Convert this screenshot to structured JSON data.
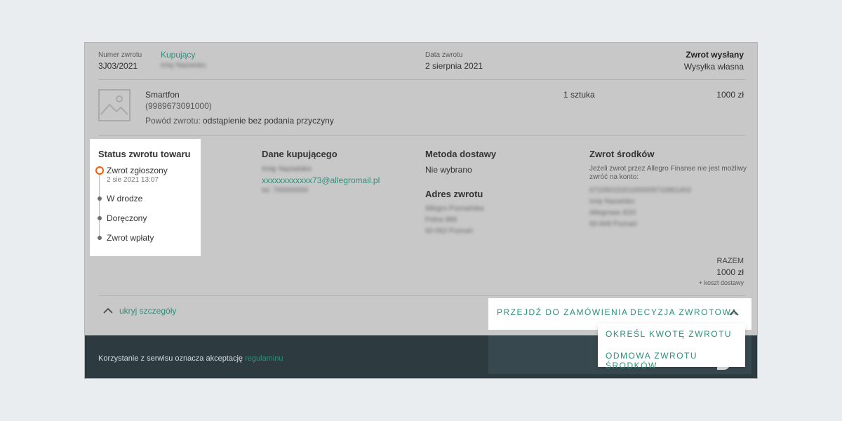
{
  "header": {
    "return_number_label": "Numer zwrotu",
    "return_number_value": "3J03/2021",
    "buyer_label": "Kupujący",
    "buyer_name": "Imię Nazwisko",
    "return_date_label": "Data zwrotu",
    "return_date_value": "2 sierpnia 2021",
    "status_title": "Zwrot wysłany",
    "status_subtitle": "Wysyłka własna"
  },
  "product": {
    "name": "Smartfon",
    "id": "(9989673091000)",
    "reason_label": "Powód zwrotu:",
    "reason_value": "odstąpienie bez podania przyczyny",
    "quantity": "1 sztuka",
    "price": "1000 zł",
    "image_icon": "image-placeholder-icon"
  },
  "status_panel": {
    "title": "Status zwrotu towaru",
    "steps": [
      {
        "label": "Zwrot zgłoszony",
        "date": "2 sie 2021 13:07"
      },
      {
        "label": "W drodze"
      },
      {
        "label": "Doręczony"
      },
      {
        "label": "Zwrot wpłaty"
      }
    ]
  },
  "buyer_data": {
    "title": "Dane kupującego",
    "name": "Imię Nazwisko",
    "email": "xxxxxxxxxxxx73@allegromail.pl",
    "phone": "tel. 700000000"
  },
  "delivery": {
    "title": "Metoda dostawy",
    "value": "Nie wybrano",
    "address_title": "Adres zwrotu",
    "address_lines": [
      "Allegro Poznańska",
      "Polna 989",
      "60-062 Poznań"
    ]
  },
  "refund": {
    "title": "Zwrot środków",
    "note": "Jeżeli zwrot przez Allegro Finanse nie jest możliwy zwróć na konto:",
    "lines": [
      "07105015201000009710861403",
      "Imię Nazwisko",
      "Allegrowa 3/20",
      "60-848 Poznań"
    ]
  },
  "total": {
    "label": "RAZEM",
    "value": "1000 zł",
    "note": "+ koszt dostawy"
  },
  "toggle": {
    "label": "ukryj szczegóły"
  },
  "actions": {
    "go_to_order": "PRZEJDŹ DO ZAMÓWIENIA",
    "decision": "DECYZJA ZWROTOWA",
    "menu": [
      "OKREŚL KWOTĘ ZWROTU",
      "ODMOWA ZWROTU ŚRODKÓW"
    ]
  },
  "footer": {
    "text": "Korzystanie z serwisu oznacza akceptację",
    "link": "regulaminu"
  },
  "colors": {
    "accent": "#2f8f7a",
    "status_active": "#ff5a00",
    "footer_bg": "#2d3b41",
    "overlay_bg": "#c8c8c8"
  }
}
